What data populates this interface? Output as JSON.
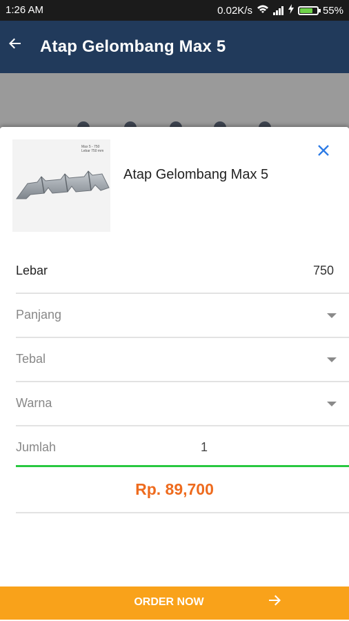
{
  "status_bar": {
    "time": "1:26 AM",
    "network_speed": "0.02K/s",
    "battery": "55%"
  },
  "app_bar": {
    "back_icon": "arrow-left-icon",
    "title": "Atap Gelombang Max 5"
  },
  "product": {
    "image_caption_line1": "Max 5 - 750",
    "image_caption_line2": "Lebar 750 mm",
    "name": "Atap Gelombang Max 5",
    "close_icon": "close-icon"
  },
  "form": {
    "lebar": {
      "label": "Lebar",
      "value": "750"
    },
    "panjang": {
      "placeholder": "Panjang"
    },
    "tebal": {
      "placeholder": "Tebal"
    },
    "warna": {
      "placeholder": "Warna"
    },
    "jumlah": {
      "label": "Jumlah",
      "value": "1"
    }
  },
  "price": "Rp. 89,700",
  "order_button": {
    "label": "ORDER NOW",
    "icon": "arrow-right-icon"
  },
  "colors": {
    "app_bar": "#213a5b",
    "price": "#ee6b1e",
    "order_button": "#f9a21a",
    "qty_underline": "#28c840",
    "close": "#2d7be5"
  }
}
